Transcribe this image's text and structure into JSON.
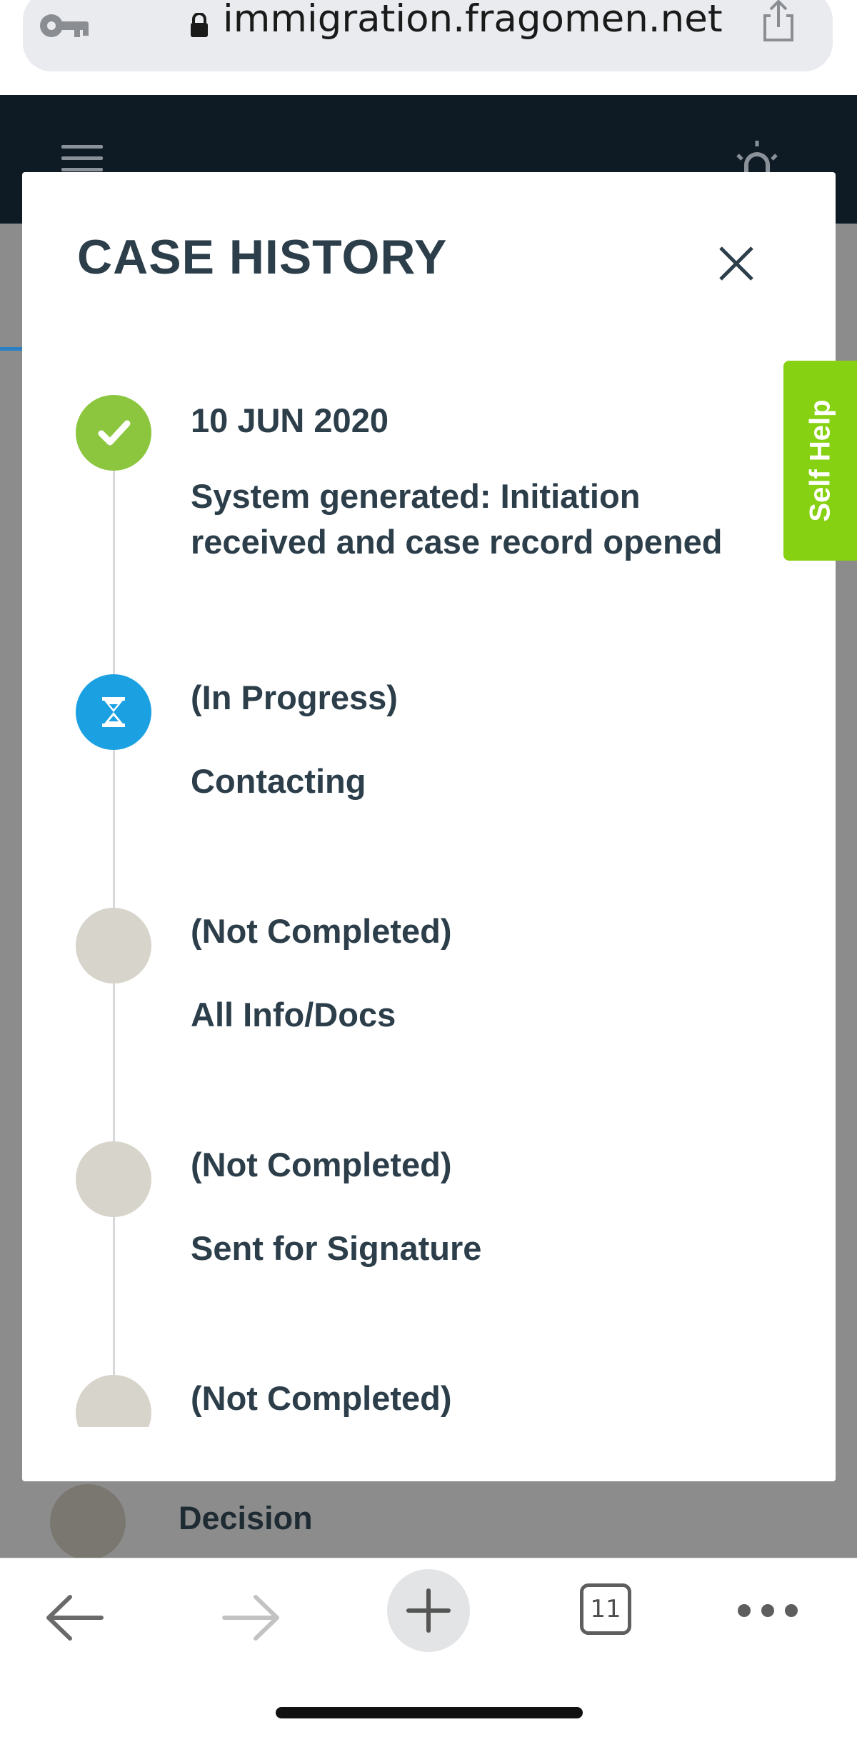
{
  "browser": {
    "url": "immigration.fragomen.net",
    "tab_count": "11"
  },
  "modal": {
    "title": "CASE HISTORY",
    "steps": [
      {
        "status": "10 JUN 2020",
        "description": "System generated: Initiation received and case record opened",
        "state": "completed"
      },
      {
        "status": "(In Progress)",
        "description": "Contacting",
        "state": "in-progress"
      },
      {
        "status": "(Not Completed)",
        "description": "All Info/Docs",
        "state": "pending"
      },
      {
        "status": "(Not Completed)",
        "description": "Sent for Signature",
        "state": "pending"
      },
      {
        "status": "(Not Completed)",
        "description": "",
        "state": "pending"
      }
    ]
  },
  "self_help": {
    "label": "Self Help"
  },
  "background": {
    "partial_step_label": "Decision"
  },
  "colors": {
    "completed": "#8cc63f",
    "in_progress": "#1ba1e2",
    "pending": "#d7d4cb",
    "self_help": "#86d112",
    "header": "#0e1b24"
  }
}
